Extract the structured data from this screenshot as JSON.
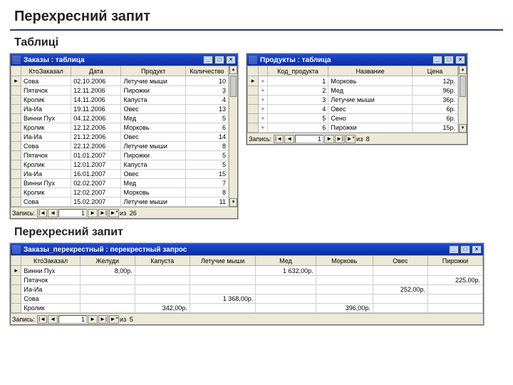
{
  "page": {
    "main_title": "Перехресний запит",
    "section_tables": "Таблиці",
    "section_cross": "Перехресний запит"
  },
  "nav": {
    "label": "Запись:",
    "first": "|◄",
    "prev": "◄",
    "next": "►",
    "last": "►|",
    "new": "►*",
    "of": "из"
  },
  "winbtn": {
    "min": "_",
    "max": "□",
    "close": "×"
  },
  "orders": {
    "title": "Заказы : таблица",
    "cols": [
      "КтоЗаказал",
      "Дата",
      "Продукт",
      "Количество"
    ],
    "rows": [
      [
        "Сова",
        "02.10.2006",
        "Летучие мыши",
        "10"
      ],
      [
        "Пятачок",
        "12.11.2006",
        "Пирожки",
        "3"
      ],
      [
        "Кролик",
        "14.11.2006",
        "Капуста",
        "4"
      ],
      [
        "Иа-Иа",
        "19.11.2006",
        "Овес",
        "13"
      ],
      [
        "Винни Пух",
        "04.12.2006",
        "Мед",
        "5"
      ],
      [
        "Кролик",
        "12.12.2006",
        "Морковь",
        "6"
      ],
      [
        "Иа-Иа",
        "21.12.2006",
        "Овес",
        "14"
      ],
      [
        "Сова",
        "22.12.2006",
        "Летучие мыши",
        "8"
      ],
      [
        "Пятачок",
        "01.01.2007",
        "Пирожки",
        "5"
      ],
      [
        "Кролик",
        "12.01.2007",
        "Капуста",
        "5"
      ],
      [
        "Иа-Иа",
        "16.01.2007",
        "Овес",
        "15"
      ],
      [
        "Винни Пух",
        "02.02.2007",
        "Мед",
        "7"
      ],
      [
        "Кролик",
        "12.02.2007",
        "Морковь",
        "8"
      ],
      [
        "Сова",
        "15.02.2007",
        "Летучие мыши",
        "11"
      ]
    ],
    "nav_pos": "1",
    "nav_total": "26"
  },
  "products": {
    "title": "Продукты : таблица",
    "cols": [
      "Код_продукта",
      "Название",
      "Цена"
    ],
    "rows": [
      [
        "1",
        "Морковь",
        "12р."
      ],
      [
        "2",
        "Мед",
        "96р."
      ],
      [
        "3",
        "Летучие мыши",
        "36р."
      ],
      [
        "4",
        "Овес",
        "6р."
      ],
      [
        "5",
        "Сено",
        "6р."
      ],
      [
        "6",
        "Пирожки",
        "15р."
      ]
    ],
    "nav_pos": "1",
    "nav_total": "8"
  },
  "cross": {
    "title": "Заказы_перекрестный : перекрестный запрос",
    "cols": [
      "КтоЗаказал",
      "Желуди",
      "Капуста",
      "Летучие мыши",
      "Мед",
      "Морковь",
      "Овес",
      "Пирожки"
    ],
    "rows": [
      [
        "Винни Пух",
        "8,00р.",
        "",
        "",
        "1 632,00р.",
        "",
        "",
        ""
      ],
      [
        "Пятачок",
        "",
        "",
        "",
        "",
        "",
        "",
        "225,00р."
      ],
      [
        "Иа-Иа",
        "",
        "",
        "",
        "",
        "",
        "252,00р.",
        ""
      ],
      [
        "Сова",
        "",
        "",
        "1 368,00р.",
        "",
        "",
        "",
        ""
      ],
      [
        "Кролик",
        "",
        "342,00р.",
        "",
        "",
        "396,00р.",
        "",
        ""
      ]
    ],
    "nav_pos": "1",
    "nav_total": "5"
  }
}
